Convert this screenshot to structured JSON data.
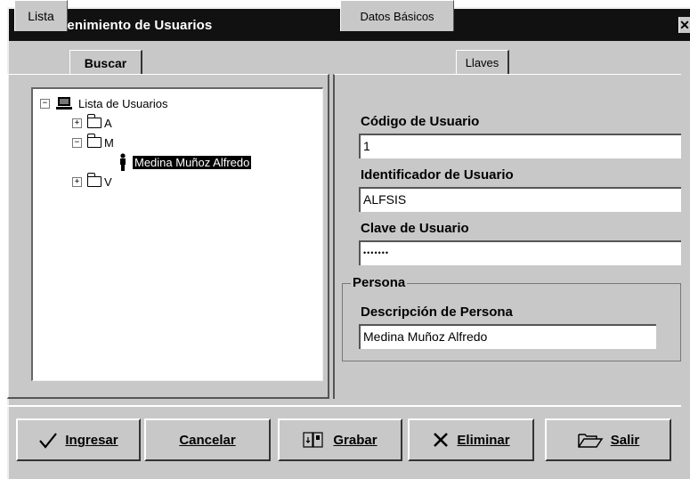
{
  "window": {
    "title": "Mantenimiento de Usuarios",
    "close_glyph": "✕"
  },
  "left_tabs": [
    {
      "label": "Lista",
      "active": true
    },
    {
      "label": "Buscar",
      "active": false
    }
  ],
  "tree": {
    "root": {
      "label": "Lista de Usuarios",
      "icon": "computer-icon",
      "toggle": "−"
    },
    "folders": [
      {
        "label": "A",
        "toggle": "+"
      },
      {
        "label": "M",
        "toggle": "−"
      },
      {
        "label": "V",
        "toggle": "+"
      }
    ],
    "selected_user": {
      "label": "Medina Muñoz Alfredo",
      "icon": "person-icon"
    }
  },
  "right_tabs": [
    {
      "label": "Datos Básicos",
      "active": true
    },
    {
      "label": "Llaves",
      "active": false
    }
  ],
  "form": {
    "codigo_label": "Código de Usuario",
    "codigo_value": "1",
    "identificador_label": "Identificador de Usuario",
    "identificador_value": "ALFSIS",
    "clave_label": "Clave de Usuario",
    "clave_value": "•••••••",
    "persona_group": "Persona",
    "descripcion_label": "Descripción de Persona",
    "descripcion_value": "Medina Muñoz Alfredo"
  },
  "buttons": {
    "ingresar": "Ingresar",
    "cancelar": "Cancelar",
    "grabar": "Grabar",
    "eliminar": "Eliminar",
    "salir": "Salir"
  },
  "colors": {
    "titlebar": "#111111",
    "face": "#c8c8c8",
    "selection": "#000000"
  }
}
